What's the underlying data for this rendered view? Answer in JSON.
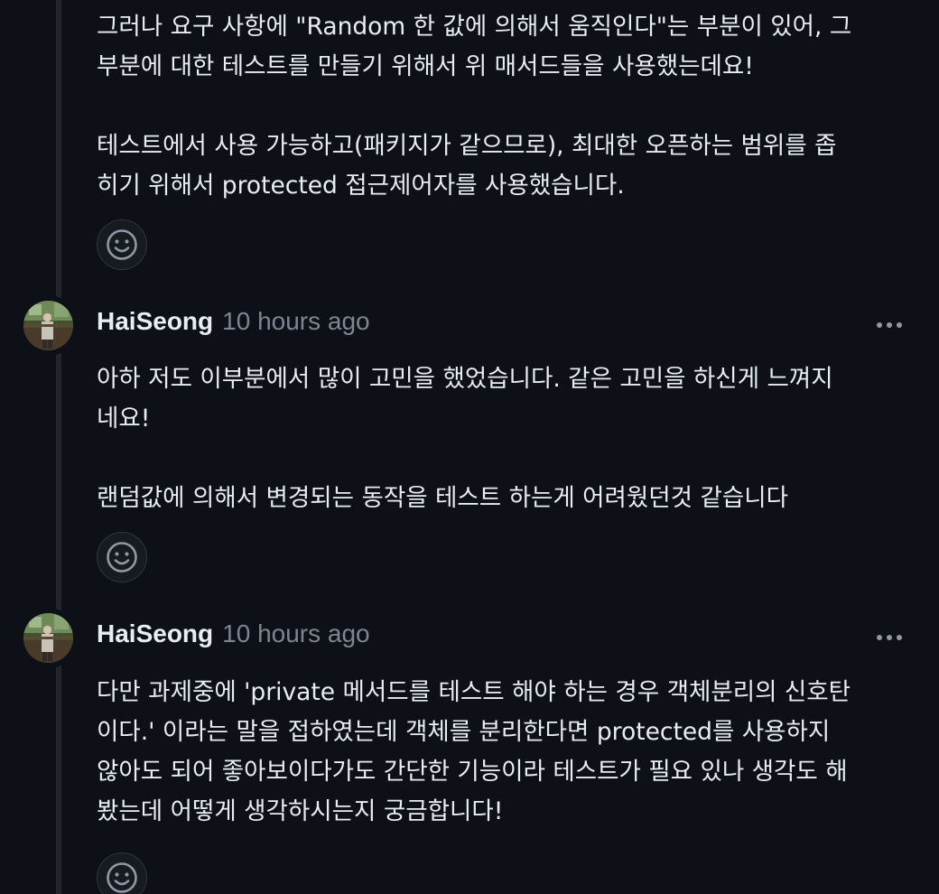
{
  "comments": [
    {
      "paragraphs": [
        "그러나 요구 사항에 \"Random 한 값에 의해서 움직인다\"는 부분이 있어, 그\n부분에 대한 테스트를 만들기 위해서 위 매서드들을 사용했는데요!",
        "테스트에서 사용 가능하고(패키지가 같으므로), 최대한 오픈하는 범위를 좁\n히기 위해서 protected 접근제어자를 사용했습니다."
      ]
    },
    {
      "author": "HaiSeong",
      "timestamp": "10 hours ago",
      "paragraphs": [
        "아하 저도 이부분에서 많이 고민을 했었습니다. 같은 고민을 하신게 느껴지\n네요!",
        "랜덤값에 의해서 변경되는 동작을 테스트 하는게 어려웠던것 같습니다"
      ]
    },
    {
      "author": "HaiSeong",
      "timestamp": "10 hours ago",
      "paragraphs": [
        "다만 과제중에 'private 메서드를 테스트 해야 하는 경우 객체분리의 신호탄\n이다.' 이라는 말을 접하였는데 객체를 분리한다면 protected를 사용하지\n않아도 되어 좋아보이다가도 간단한 기능이라 테스트가 필요 있나 생각도 해\n봤는데 어떻게 생각하시는지 궁금합니다!"
      ]
    }
  ],
  "icons": {
    "reaction": "smiley-face-icon",
    "menu": "kebab-horizontal-icon",
    "avatar": "user-avatar-photo"
  },
  "colors": {
    "background": "#0d1117",
    "text": "#e6edf3",
    "muted": "#7d8590",
    "border": "#30363d",
    "button_bg": "#161b22"
  }
}
